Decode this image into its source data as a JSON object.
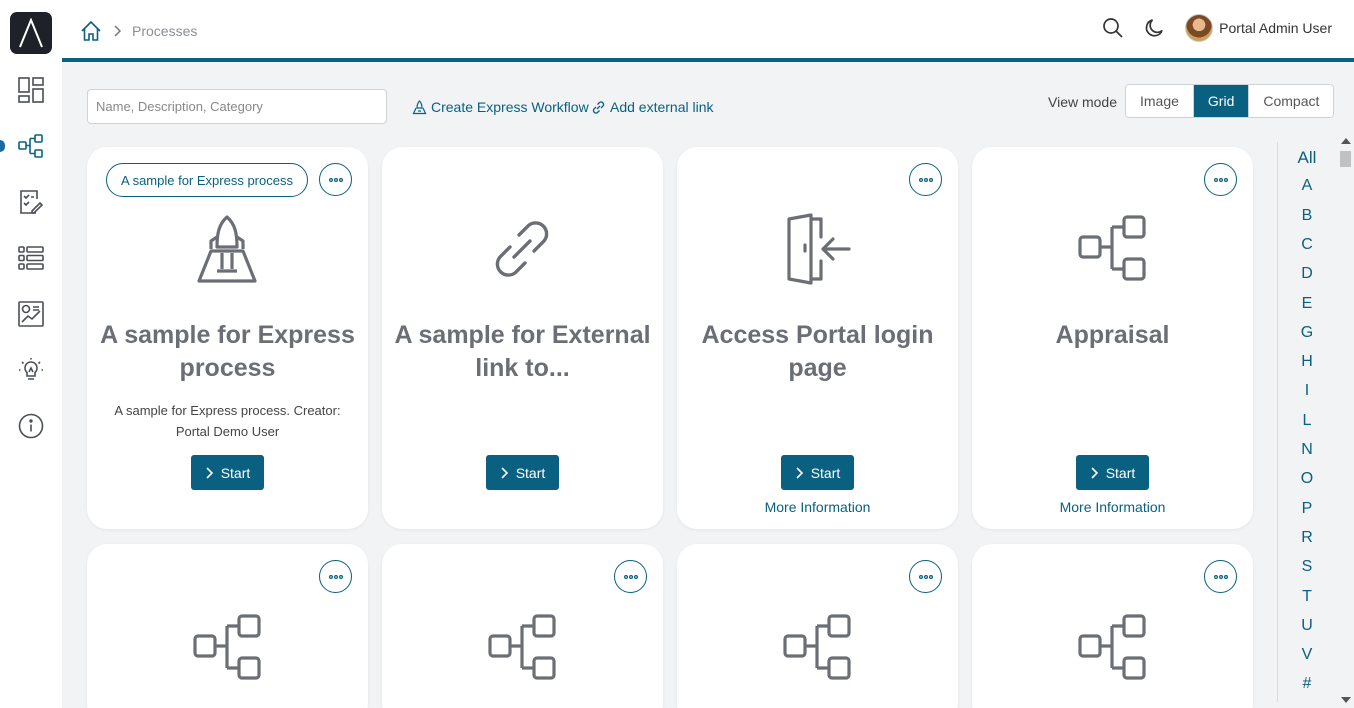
{
  "breadcrumb": {
    "current": "Processes"
  },
  "header": {
    "user_name": "Portal Admin User"
  },
  "search": {
    "placeholder": "Name, Description, Category",
    "value": ""
  },
  "toolbar": {
    "create_express": "Create Express Workflow",
    "add_external": "Add external link",
    "view_mode_label": "View mode",
    "view_modes": [
      "Image",
      "Grid",
      "Compact"
    ],
    "active_view": "Grid"
  },
  "cards": [
    {
      "title": "A sample for Express process",
      "category": "A sample for Express process",
      "description": "A sample for Express process. Creator: Portal Demo User",
      "icon": "rocket-icon",
      "start": "Start",
      "more_info": ""
    },
    {
      "title": "A sample for External link to...",
      "category": "",
      "description": "",
      "icon": "link-icon",
      "start": "Start",
      "more_info": ""
    },
    {
      "title": "Access Portal login page",
      "category": "",
      "description": "",
      "icon": "login-door-icon",
      "start": "Start",
      "more_info": "More Information"
    },
    {
      "title": "Appraisal",
      "category": "",
      "description": "",
      "icon": "process-tree-icon",
      "start": "Start",
      "more_info": "More Information"
    }
  ],
  "alpha_index": [
    "All",
    "A",
    "B",
    "C",
    "D",
    "E",
    "G",
    "H",
    "I",
    "L",
    "N",
    "O",
    "P",
    "R",
    "S",
    "T",
    "U",
    "V",
    "#"
  ],
  "colors": {
    "primary": "#0a6080",
    "logo_bg": "#1e2127",
    "icon_gray": "#6b6f75"
  }
}
